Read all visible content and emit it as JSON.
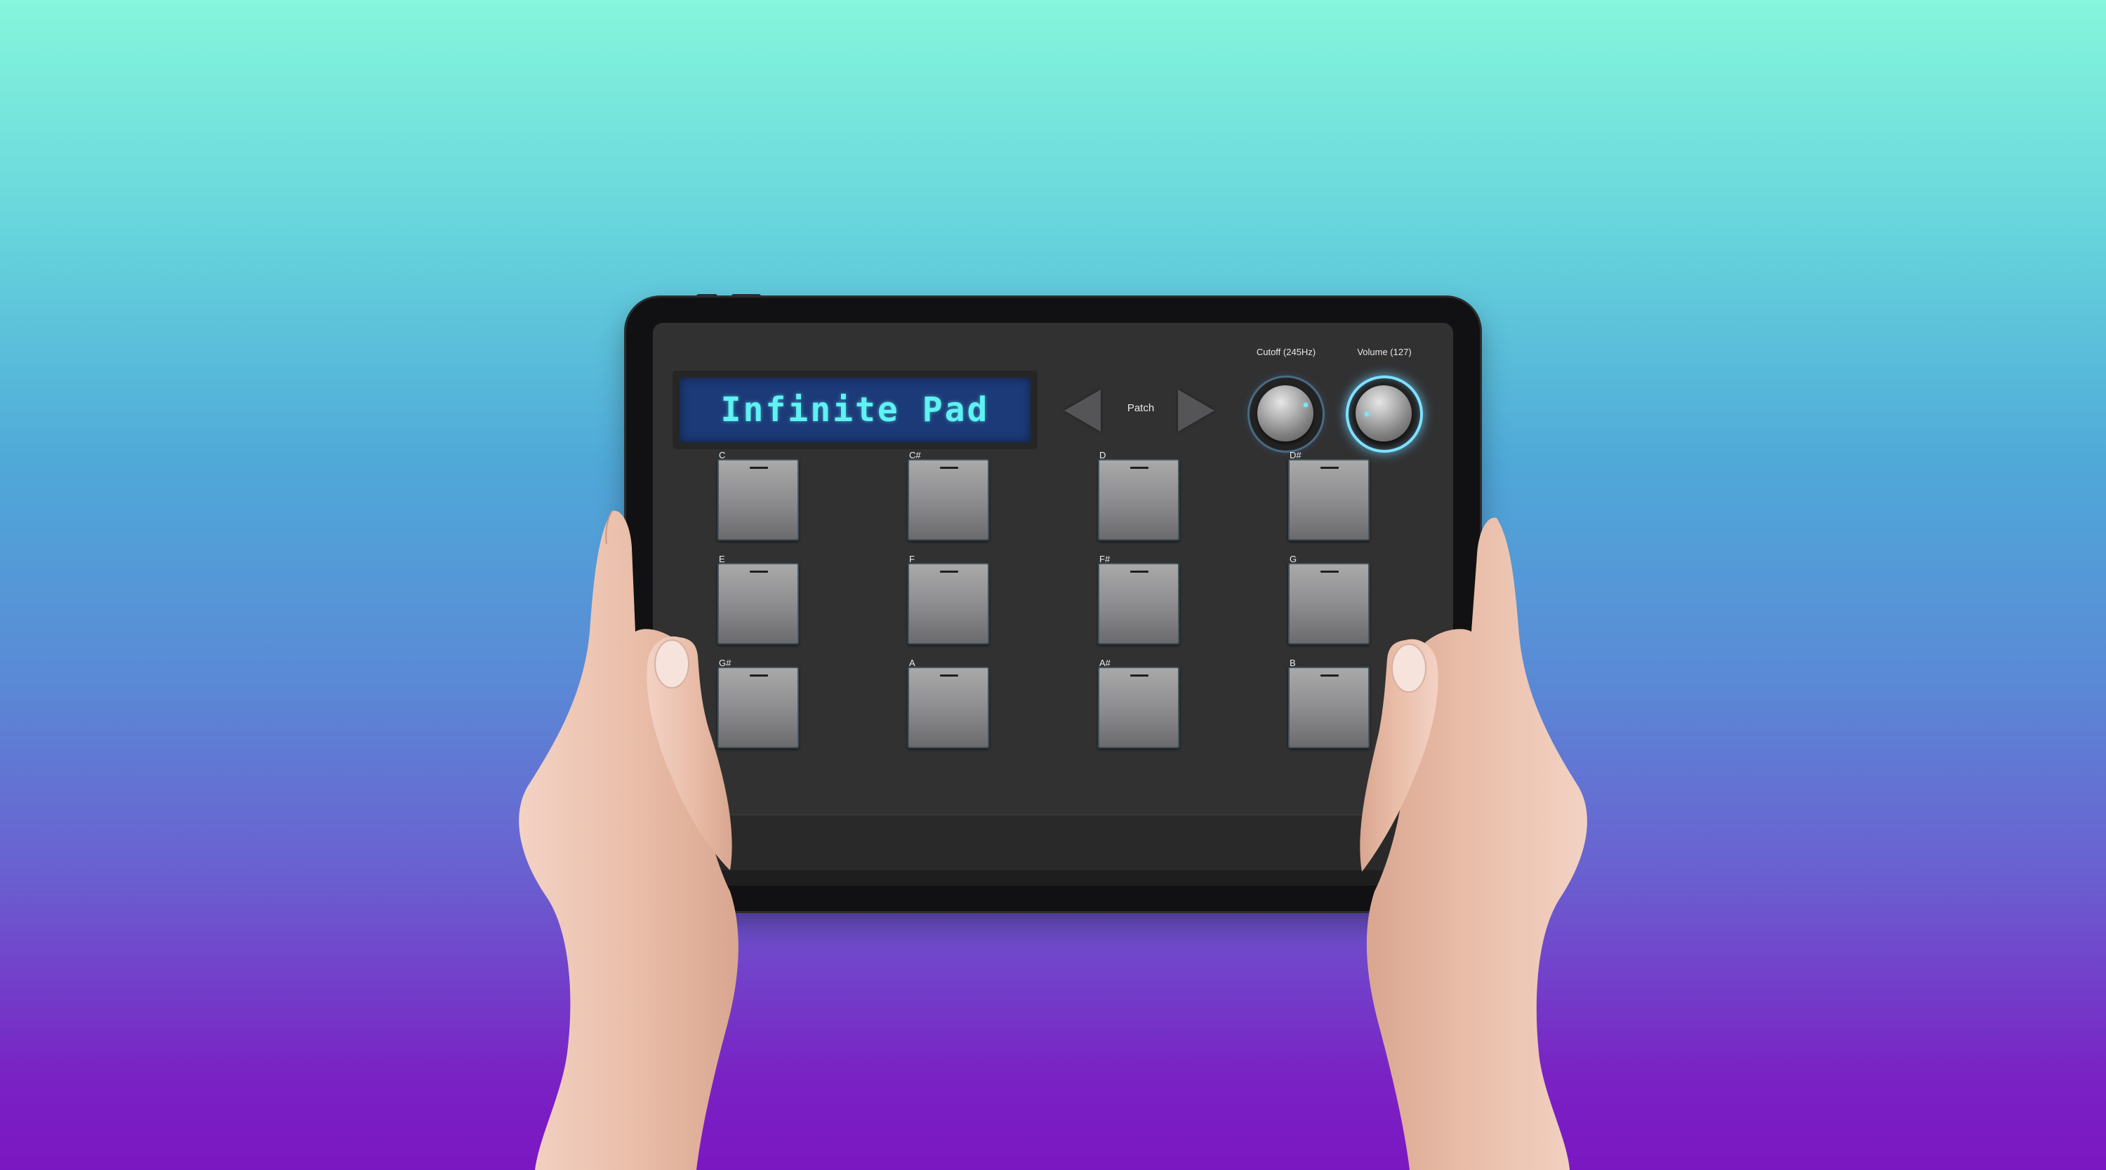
{
  "app": {
    "display_text": "Infinite Pad",
    "patch_label": "Patch",
    "knobs": [
      {
        "label": "Cutoff (245Hz)",
        "name": "cutoff",
        "active": false
      },
      {
        "label": "Volume (127)",
        "name": "volume",
        "active": true
      }
    ],
    "pads": [
      {
        "note": "C"
      },
      {
        "note": "C#"
      },
      {
        "note": "D"
      },
      {
        "note": "D#"
      },
      {
        "note": "E"
      },
      {
        "note": "F"
      },
      {
        "note": "F#"
      },
      {
        "note": "G"
      },
      {
        "note": "G#"
      },
      {
        "note": "A"
      },
      {
        "note": "A#"
      },
      {
        "note": "B"
      }
    ]
  },
  "colors": {
    "lcd_background": "#1c3a78",
    "lcd_text": "#5ff2f2",
    "knob_glow": "#7ee0ff",
    "screen_background": "#313132",
    "pad_face": "#9a9a9b"
  },
  "icons": {
    "prev_patch": "triangle-left-icon",
    "next_patch": "triangle-right-icon"
  }
}
